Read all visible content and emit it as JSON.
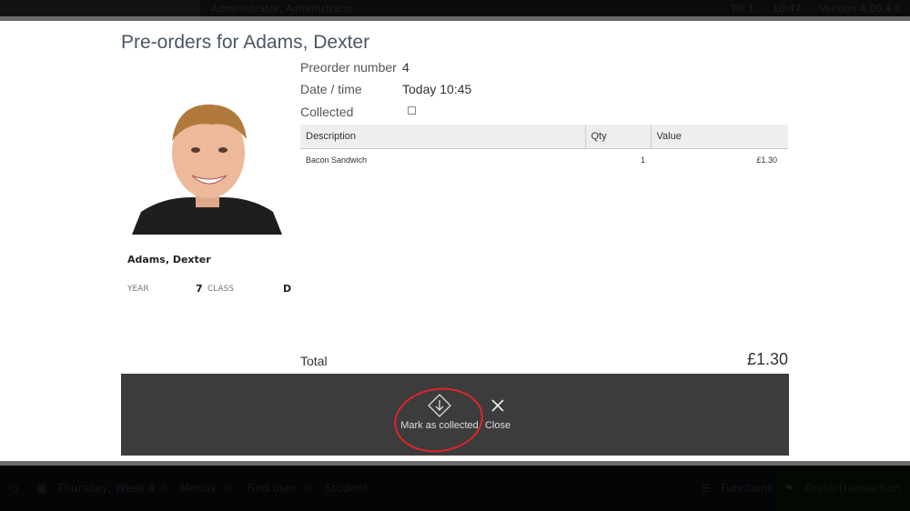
{
  "topbar": {
    "user": "Administrator, Administrator",
    "till": "Till 1",
    "time": "10:47",
    "version": "Version 4.00.4.0"
  },
  "modal": {
    "title": "Pre-orders for Adams, Dexter",
    "student": {
      "name": "Adams, Dexter",
      "year_label": "YEAR",
      "year": "7",
      "class_label": "CLASS",
      "class": "D"
    },
    "preorder_label": "Preorder number",
    "preorder_number": "4",
    "date_label": "Date / time",
    "date_value": "Today 10:45",
    "collected_label": "Collected",
    "collected": false,
    "table": {
      "headers": [
        "Description",
        "Qty",
        "Value"
      ],
      "rows": [
        {
          "description": "Bacon Sandwich",
          "qty": "1",
          "value": "£1.30"
        }
      ]
    },
    "total_label": "Total",
    "total_value": "£1.30",
    "actions": {
      "mark_collected": "Mark as collected",
      "close": "Close"
    },
    "highlight_color": "#e0252b"
  },
  "bottombar": {
    "day": "Thursday, Week 4",
    "menus": "Menus",
    "find_user": "Find user",
    "student": "Student",
    "functions": "Functions",
    "finish": "Finish transaction"
  }
}
